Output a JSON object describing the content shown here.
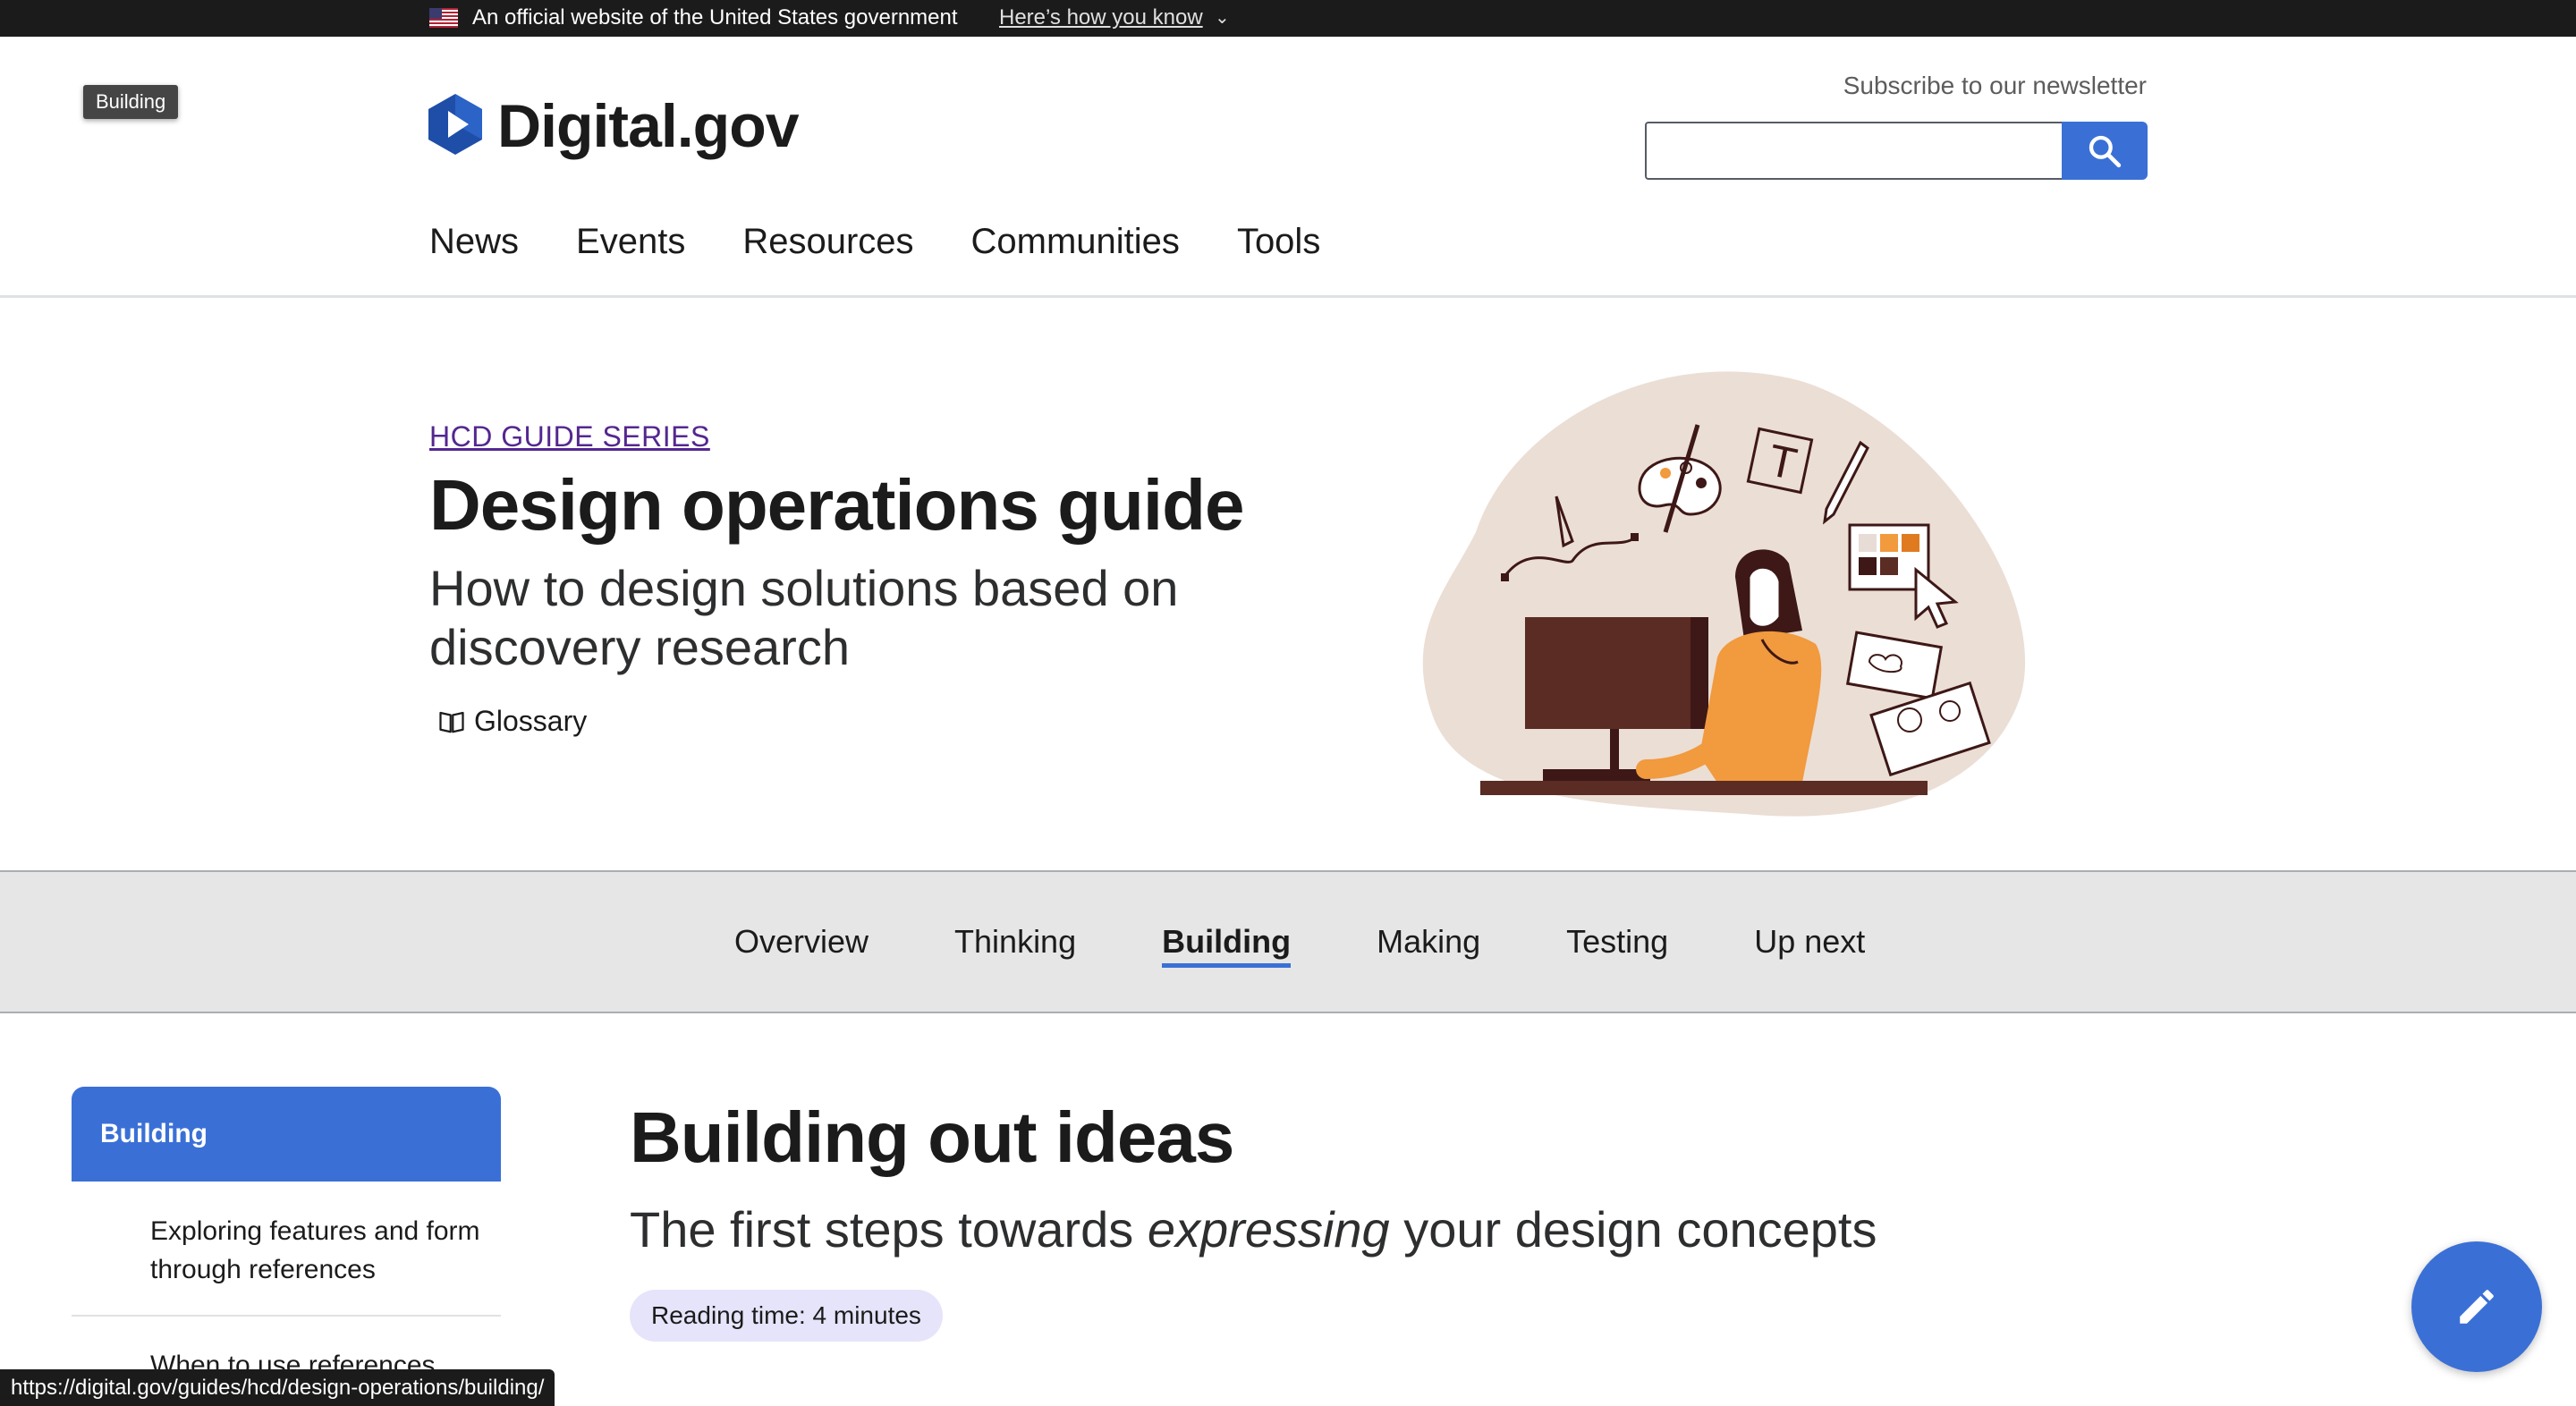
{
  "gov_banner": {
    "text": "An official website of the United States government",
    "link": "Here’s how you know",
    "chevron": "⌄"
  },
  "tooltip": "Building",
  "header": {
    "logo_text": "Digital.gov",
    "subscribe": "Subscribe to our newsletter",
    "search_value": "",
    "nav": [
      "News",
      "Events",
      "Resources",
      "Communities",
      "Tools"
    ]
  },
  "hero": {
    "series": "HCD GUIDE SERIES",
    "title": "Design operations guide",
    "subtitle": "How to design solutions based on discovery research",
    "glossary": "Glossary",
    "art_letter": "T",
    "art_palette": [
      "#e8ddd6",
      "#f19a3e",
      "#e07a1f",
      "#3d1816",
      "#5a2c24"
    ]
  },
  "subnav": {
    "items": [
      "Overview",
      "Thinking",
      "Building",
      "Making",
      "Testing",
      "Up next"
    ],
    "active": "Building"
  },
  "sidebar": {
    "heading": "Building",
    "items": [
      "Exploring features and form through references",
      "When to use references"
    ]
  },
  "main": {
    "title": "Building out ideas",
    "sub_before": "The first steps towards ",
    "sub_em": "expressing",
    "sub_after": " your design concepts",
    "reading_time": "Reading time: 4 minutes"
  },
  "status_url": "https://digital.gov/guides/hcd/design-operations/building/",
  "icons": {
    "flag": "us-flag-icon",
    "logo": "digital-gov-logo-icon",
    "search": "search-icon",
    "glossary": "book-icon",
    "edit": "pencil-icon"
  },
  "colors": {
    "primary": "#3a70d6",
    "banner": "#1b1b1b",
    "series_link": "#54278f",
    "subnav_bg": "#e6e6e6",
    "reading_badge": "#e5e4fa"
  }
}
